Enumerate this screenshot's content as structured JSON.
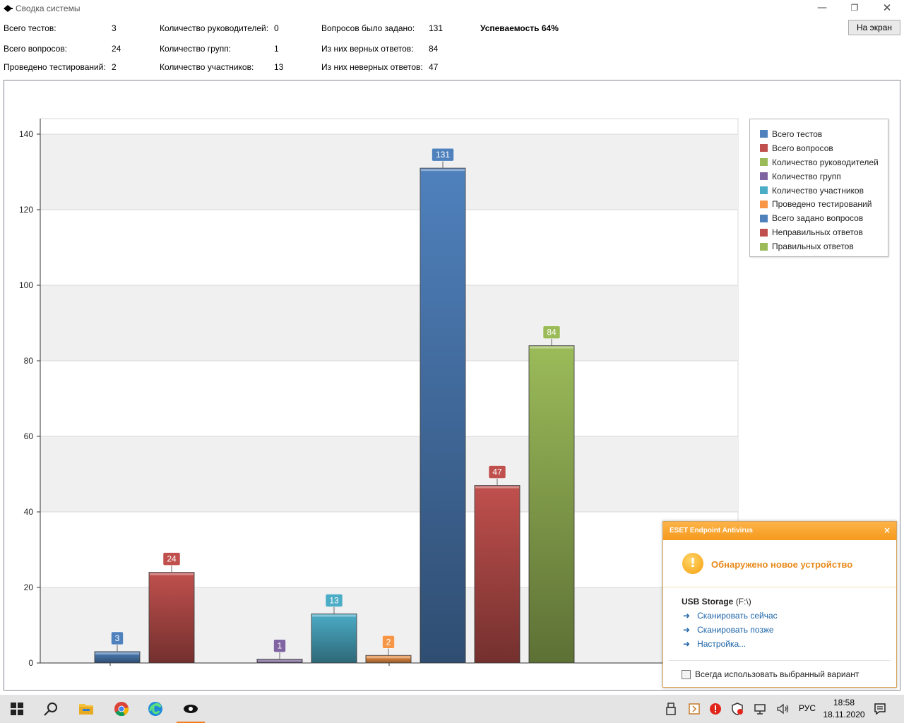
{
  "window": {
    "title": "Сводка системы"
  },
  "stats": {
    "total_tests_label": "Всего тестов:",
    "total_tests": "3",
    "total_questions_label": "Всего вопросов:",
    "total_questions": "24",
    "tests_conducted_label": "Проведено тестирований:",
    "tests_conducted": "2",
    "managers_label": "Количество руководителей:",
    "managers": "0",
    "groups_label": "Количество групп:",
    "groups": "1",
    "participants_label": "Количество участников:",
    "participants": "13",
    "asked_label": "Вопросов было задано:",
    "asked": "131",
    "correct_label": "Из них верных ответов:",
    "correct": "84",
    "wrong_label": "Из них неверных ответов:",
    "wrong": "47",
    "performance_label": "Успеваемость",
    "performance": "64%"
  },
  "screen_button": "На экран",
  "chart_data": {
    "type": "bar",
    "ylim": [
      0,
      140
    ],
    "yticks": [
      0,
      20,
      40,
      60,
      80,
      100,
      120,
      140
    ],
    "series": [
      {
        "name": "Всего тестов",
        "value": 3,
        "color": "#4f81bd"
      },
      {
        "name": "Всего вопросов",
        "value": 24,
        "color": "#c0504d"
      },
      {
        "name": "Количество руководителей",
        "value": 0,
        "color": "#9bbb59"
      },
      {
        "name": "Количество групп",
        "value": 1,
        "color": "#8064a2"
      },
      {
        "name": "Количество участников",
        "value": 13,
        "color": "#4bacc6"
      },
      {
        "name": "Проведено тестирований",
        "value": 2,
        "color": "#f79646"
      },
      {
        "name": "Всего задано вопросов",
        "value": 131,
        "color": "#4f81bd"
      },
      {
        "name": "Неправильных ответов",
        "value": 47,
        "color": "#c0504d"
      },
      {
        "name": "Правильных ответов",
        "value": 84,
        "color": "#9bbb59"
      }
    ]
  },
  "eset": {
    "title": "ESET Endpoint Antivirus",
    "headline": "Обнаружено новое устройство",
    "device_name": "USB Storage",
    "device_drive": "(F:\\)",
    "scan_now": "Сканировать сейчас",
    "scan_later": "Сканировать позже",
    "settings": "Настройка...",
    "always_use": "Всегда использовать выбранный вариант"
  },
  "taskbar": {
    "language": "РУС",
    "time": "18:58",
    "date": "18.11.2020"
  }
}
